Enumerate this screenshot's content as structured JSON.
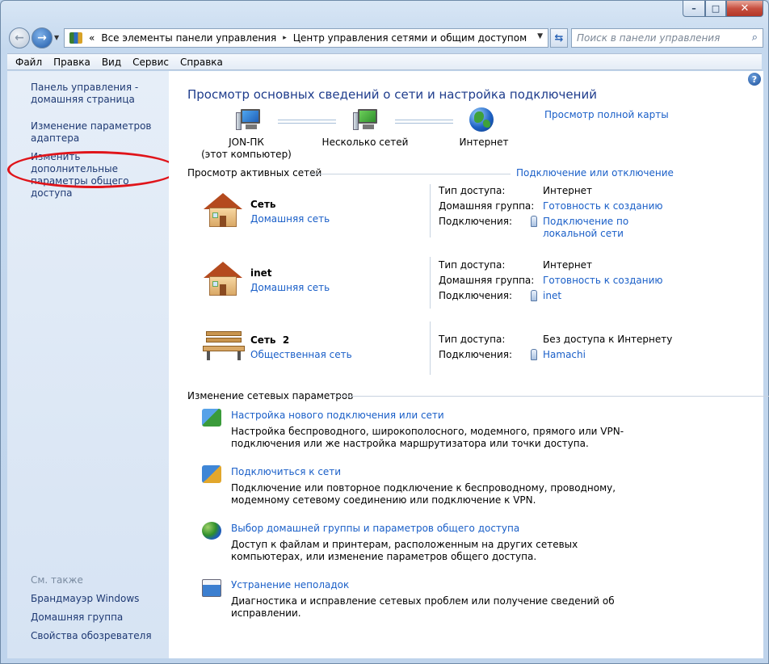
{
  "window": {
    "caption_buttons": {
      "minimize": "–",
      "maximize": "□",
      "close": "✕"
    }
  },
  "address_bar": {
    "prefix": "«",
    "crumbs": [
      "Все элементы панели управления",
      "Центр управления сетями и общим доступом"
    ],
    "separator": "▸",
    "search_placeholder": "Поиск в панели управления"
  },
  "menu": [
    "Файл",
    "Правка",
    "Вид",
    "Сервис",
    "Справка"
  ],
  "sidebar": {
    "links": [
      "Панель управления - домашняя страница",
      "Изменение параметров адаптера",
      "Изменить дополнительные параметры общего доступа"
    ],
    "see_also_title": "См. также",
    "see_also": [
      "Брандмауэр Windows",
      "Домашняя группа",
      "Свойства обозревателя"
    ]
  },
  "main": {
    "title": "Просмотр основных сведений о сети и настройка подключений",
    "full_map_link": "Просмотр полной карты",
    "map": {
      "computer_name": "JON-ПК",
      "computer_sub": "(этот компьютер)",
      "middle": "Несколько сетей",
      "internet": "Интернет"
    },
    "active_header": "Просмотр активных сетей",
    "connect_link": "Подключение или отключение",
    "networks": [
      {
        "name": "Сеть",
        "type": "Домашняя сеть",
        "rows": [
          {
            "k": "Тип доступа:",
            "v": "Интернет",
            "link": false
          },
          {
            "k": "Домашняя группа:",
            "v": "Готовность к созданию",
            "link": true
          },
          {
            "k": "Подключения:",
            "v": "Подключение по локальной сети",
            "link": true
          }
        ]
      },
      {
        "name": "inet",
        "type": "Домашняя сеть",
        "rows": [
          {
            "k": "Тип доступа:",
            "v": "Интернет",
            "link": false
          },
          {
            "k": "Домашняя группа:",
            "v": "Готовность к созданию",
            "link": true
          },
          {
            "k": "Подключения:",
            "v": "inet",
            "link": true
          }
        ]
      },
      {
        "name": "Сеть  2",
        "type": "Общественная сеть",
        "rows": [
          {
            "k": "Тип доступа:",
            "v": "Без доступа к Интернету",
            "link": false
          },
          {
            "k": "Подключения:",
            "v": "Hamachi",
            "link": true
          }
        ]
      }
    ],
    "change_header": "Изменение сетевых параметров",
    "tasks": [
      {
        "title": "Настройка нового подключения или сети",
        "icon": "new-connection-icon",
        "desc": "Настройка беспроводного, широкополосного, модемного, прямого или VPN-подключения или же настройка маршрутизатора или точки доступа."
      },
      {
        "title": "Подключиться к сети",
        "icon": "connect-network-icon",
        "desc": "Подключение или повторное подключение к беспроводному, проводному, модемному сетевому соединению или подключение к VPN."
      },
      {
        "title": "Выбор домашней группы и параметров общего доступа",
        "icon": "homegroup-icon",
        "desc": "Доступ к файлам и принтерам, расположенным на других сетевых компьютерах, или изменение параметров общего доступа."
      },
      {
        "title": "Устранение неполадок",
        "icon": "troubleshoot-icon",
        "desc": "Диагностика и исправление сетевых проблем или получение сведений об исправлении."
      }
    ]
  },
  "colors": {
    "link": "#1a5fc8",
    "title": "#1e3c8c",
    "annotation": "#e0141a"
  }
}
